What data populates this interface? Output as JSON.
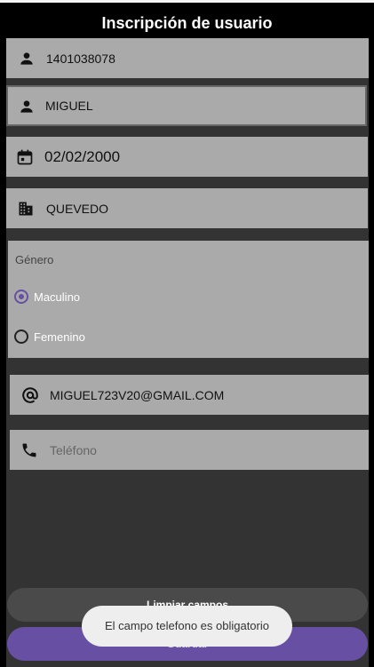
{
  "header": {
    "title": "Inscripción de usuario"
  },
  "form": {
    "id_number": {
      "value": "1401038078",
      "icon": "person-icon"
    },
    "name": {
      "value": "MIGUEL",
      "icon": "person-icon"
    },
    "birthdate": {
      "value": "02/02/2000",
      "icon": "calendar-icon"
    },
    "city": {
      "value": "QUEVEDO",
      "icon": "building-icon"
    },
    "gender": {
      "label": "Género",
      "options": [
        {
          "label": "Maculino",
          "selected": true
        },
        {
          "label": "Femenino",
          "selected": false
        }
      ]
    },
    "email": {
      "value": "MIGUEL723V20@GMAIL.COM",
      "icon": "at-sign-icon"
    },
    "phone": {
      "placeholder": "Teléfono",
      "value": "",
      "icon": "phone-icon"
    }
  },
  "buttons": {
    "clear_label": "Limpiar campos",
    "save_label": "Guardar"
  },
  "toast": {
    "message": "El campo telefono es obligatorio"
  },
  "colors": {
    "accent": "#6750a4",
    "field_bg": "#aaaaaa",
    "content_bg": "#333333",
    "header_bg": "#000000"
  }
}
